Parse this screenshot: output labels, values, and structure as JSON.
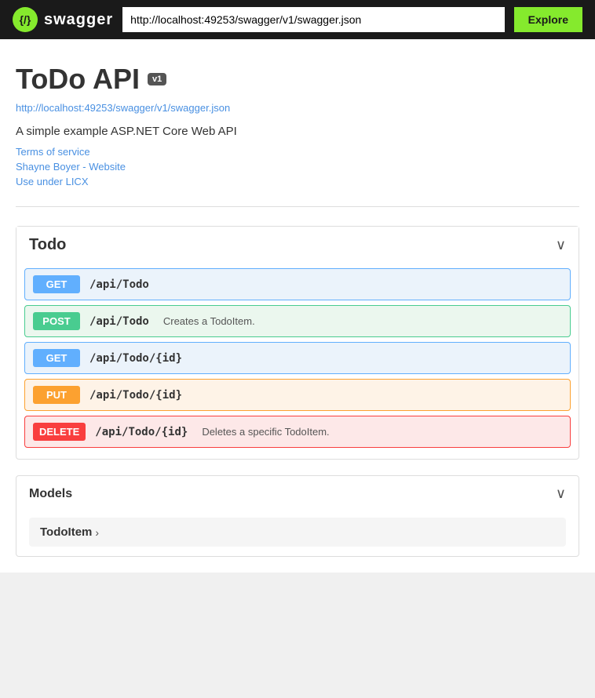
{
  "navbar": {
    "brand": "swagger",
    "url_value": "http://localhost:49253/swagger/v1/swagger.json",
    "explore_label": "Explore",
    "swagger_symbol": "{/}"
  },
  "api": {
    "title": "ToDo API",
    "version_badge": "v1",
    "url_link": "http://localhost:49253/swagger/v1/swagger.json",
    "description": "A simple example ASP.NET Core Web API",
    "terms_label": "Terms of service",
    "website_label": "Shayne Boyer - Website",
    "license_label": "Use under LICX"
  },
  "todo_section": {
    "title": "Todo",
    "chevron": "∨",
    "endpoints": [
      {
        "method": "GET",
        "method_class": "get",
        "path": "/api/Todo",
        "description": ""
      },
      {
        "method": "POST",
        "method_class": "post",
        "path": "/api/Todo",
        "description": "Creates a TodoItem."
      },
      {
        "method": "GET",
        "method_class": "get",
        "path": "/api/Todo/{id}",
        "description": ""
      },
      {
        "method": "PUT",
        "method_class": "put",
        "path": "/api/Todo/{id}",
        "description": ""
      },
      {
        "method": "DELETE",
        "method_class": "delete",
        "path": "/api/Todo/{id}",
        "description": "Deletes a specific TodoItem."
      }
    ]
  },
  "models_section": {
    "title": "Models",
    "chevron": "∨",
    "items": [
      {
        "name": "TodoItem"
      }
    ]
  }
}
